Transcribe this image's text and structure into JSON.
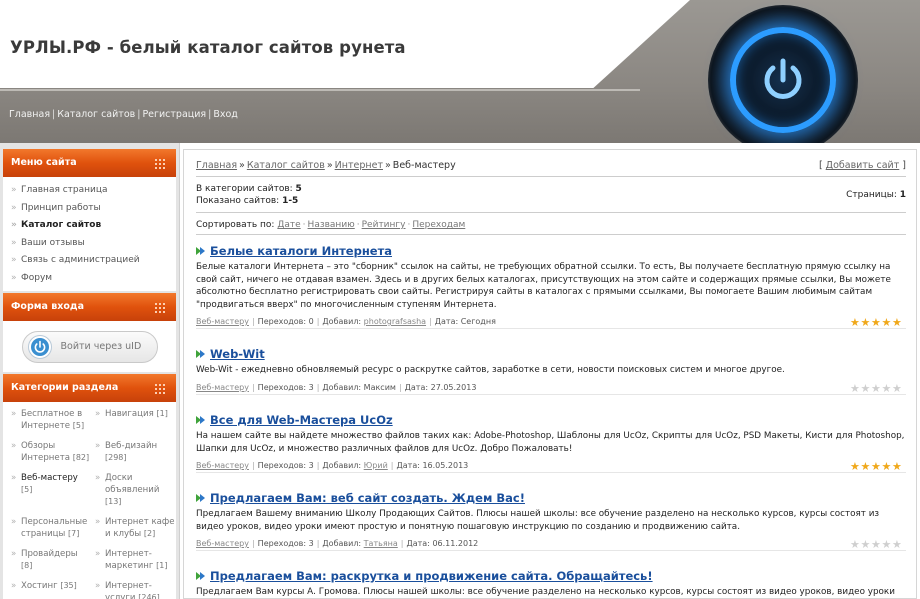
{
  "header": {
    "site_title": "УРЛЫ.РФ - белый каталог сайтов рунета",
    "nav": [
      "Главная",
      "Каталог сайтов",
      "Регистрация",
      "Вход"
    ]
  },
  "sidebar": {
    "menu_title": "Меню сайта",
    "menu_items": [
      {
        "label": "Главная страница",
        "active": false
      },
      {
        "label": "Принцип работы",
        "active": false
      },
      {
        "label": "Каталог сайтов",
        "active": true
      },
      {
        "label": "Ваши отзывы",
        "active": false
      },
      {
        "label": "Связь с администрацией",
        "active": false
      },
      {
        "label": "Форум",
        "active": false
      }
    ],
    "login_title": "Форма входа",
    "login_button": "Войти через uID",
    "categories_title": "Категории раздела",
    "categories": [
      {
        "label": "Бесплатное в Интернете",
        "count": "[5]"
      },
      {
        "label": "Навигация",
        "count": "[1]"
      },
      {
        "label": "Обзоры Интернета",
        "count": "[82]"
      },
      {
        "label": "Веб-дизайн",
        "count": "[298]"
      },
      {
        "label": "Веб-мастеру",
        "count": "[5]"
      },
      {
        "label": "Доски объявлений",
        "count": "[13]"
      },
      {
        "label": "Персональные страницы",
        "count": "[7]"
      },
      {
        "label": "Интернет кафе и клубы",
        "count": "[2]"
      },
      {
        "label": "Провайдеры",
        "count": "[8]"
      },
      {
        "label": "Интернет-маркетинг",
        "count": "[1]"
      },
      {
        "label": "Хостинг",
        "count": "[35]"
      },
      {
        "label": "Интернет-услуги",
        "count": "[246]"
      }
    ]
  },
  "main": {
    "breadcrumb": [
      "Главная",
      "Каталог сайтов",
      "Интернет",
      "Веб-мастеру"
    ],
    "breadcrumb_sep": "»",
    "add_site": "Добавить сайт",
    "stats_line1_label": "В категории сайтов:",
    "stats_line1_value": "5",
    "stats_line2_label": "Показано сайтов:",
    "stats_line2_value": "1-5",
    "pages_label": "Страницы:",
    "pages_value": "1",
    "sort_label": "Сортировать по:",
    "sort_options": [
      "Дате",
      "Названию",
      "Рейтингу",
      "Переходам"
    ],
    "entries": [
      {
        "title": "Белые каталоги Интернета",
        "desc": "Белые каталоги Интернета – это \"сборник\" ссылок на сайты, не требующих обратной ссылки. То есть, Вы получаете бесплатную прямую ссылку на свой сайт, ничего не отдавая взамен. Здесь и в других белых каталогах, присутствующих на этом сайте и содержащих прямые ссылки, Вы можете абсолютно бесплатно регистрировать свои сайты. Регистрируя сайты в каталогах с прямыми ссылками, Вы помогаете Вашим любимым сайтам \"продвигаться вверх\" по многочисленным ступеням Интернета.",
        "category": "Веб-мастеру",
        "visits": "Переходов: 0",
        "added_label": "Добавил:",
        "author": "photografsasha",
        "author_link": true,
        "date": "Дата: Сегодня",
        "rating": 5
      },
      {
        "title": "Web-Wit",
        "desc": "Web-Wit - ежедневно обновляемый ресурс о раскрутке сайтов, заработке в сети, новости поисковых систем и многое другое.",
        "category": "Веб-мастеру",
        "visits": "Переходов: 3",
        "added_label": "Добавил:",
        "author": "Максим",
        "author_link": false,
        "date": "Дата: 27.05.2013",
        "rating": 0
      },
      {
        "title": "Все для Web-Мастера UcOz",
        "desc": "На нашем сайте вы найдете множество файлов таких как: Adobe-Photoshop, Шаблоны для UcOz, Скрипты для UcOz, PSD Макеты, Кисти для Photoshop, Шапки для UcOz, и множество различных файлов для UcOz. Добро Пожаловать!",
        "category": "Веб-мастеру",
        "visits": "Переходов: 3",
        "added_label": "Добавил:",
        "author": "Юрий",
        "author_link": true,
        "date": "Дата: 16.05.2013",
        "rating": 5
      },
      {
        "title": "Предлагаем Вам: веб сайт создать. Ждем Вас!",
        "desc": "Предлагаем Вашему вниманию Школу Продающих Сайтов. Плюсы нашей школы: все обучение разделено на несколько курсов, курсы состоят из видео уроков, видео уроки имеют простую и понятную пошаговую инструкцию по созданию и продвижению сайта.",
        "category": "Веб-мастеру",
        "visits": "Переходов: 3",
        "added_label": "Добавил:",
        "author": "Татьяна",
        "author_link": true,
        "date": "Дата: 06.11.2012",
        "rating": 0
      },
      {
        "title": "Предлагаем Вам: раскрутка и продвижение сайта. Обращайтесь!",
        "desc": "Предлагаем Вам курсы А. Громова. Плюсы нашей школы: все обучение разделено на несколько курсов, курсы состоят из видео уроков, видео уроки имеют",
        "category": "",
        "visits": "",
        "added_label": "",
        "author": "",
        "author_link": false,
        "date": "",
        "rating": 0
      }
    ]
  },
  "colors": {
    "accent_orange": "#e0520d",
    "link_blue": "#1a4f9c",
    "star_on": "#f0a81a",
    "star_off": "#cfcfcf",
    "glow_blue": "#2c9cff"
  }
}
